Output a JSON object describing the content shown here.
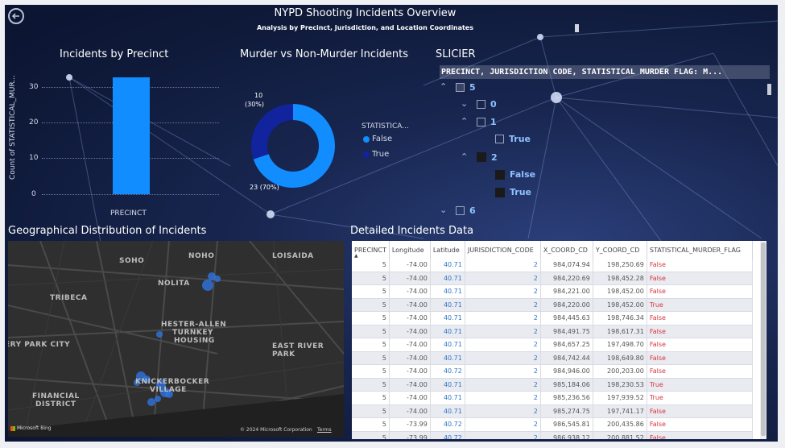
{
  "header": {
    "title": "NYPD Shooting Incidents Overview",
    "subtitle": "Analysis by Precinct, Jurisdiction, and Location Coordinates"
  },
  "bar_panel": {
    "title": "Incidents by Precinct",
    "ylabel": "Count of STATISTICAL_MUR...",
    "xlabel": "PRECINCT",
    "ticks": [
      "0",
      "10",
      "20",
      "30"
    ]
  },
  "donut_panel": {
    "title": "Murder vs Non-Murder Incidents",
    "label_true": "10",
    "label_true_pct": "(30%)",
    "label_false": "23 (70%)",
    "legend_title": "STATISTICA...",
    "legend": [
      {
        "name": "False",
        "color": "#118dff"
      },
      {
        "name": "True",
        "color": "#12239e"
      }
    ]
  },
  "slicer": {
    "title": "SLICIER",
    "header": "PRECINCT, JURISDICTION CODE, STATISTICAL MURDER FLAG: M...",
    "items": [
      "5",
      "0",
      "1",
      "True",
      "2",
      "False",
      "True",
      "6"
    ]
  },
  "map_panel": {
    "title": "Geographical Distribution of Incidents",
    "labels": {
      "soho": "SOHO",
      "noho": "NOHO",
      "loisaida": "LOISAIDA",
      "nolita": "NOLITA",
      "tribeca": "TRIBECA",
      "hester": "HESTER-ALLEN",
      "turnkey": "TURNKEY",
      "housing": "HOUSING",
      "park_city": "ERY PARK CITY",
      "east_river": "EAST RIVER PARK",
      "knickerbocker": "KNICKERBOCKER",
      "village": "VILLAGE",
      "financial": "FINANCIAL",
      "district": "DISTRICT",
      "bing": "Microsoft Bing",
      "copyright": "© 2024 Microsoft Corporation",
      "terms": "Terms"
    }
  },
  "table_panel": {
    "title": "Detailed Incidents Data",
    "columns": [
      "PRECINCT",
      "Longitude",
      "Latitude",
      "JURISDICTION_CODE",
      "X_COORD_CD",
      "Y_COORD_CD",
      "STATISTICAL_MURDER_FLAG"
    ],
    "rows": [
      [
        "5",
        "-74.00",
        "40.71",
        "2",
        "984,074.94",
        "198,250.69",
        "False"
      ],
      [
        "5",
        "-74.00",
        "40.71",
        "2",
        "984,220.69",
        "198,452.28",
        "False"
      ],
      [
        "5",
        "-74.00",
        "40.71",
        "2",
        "984,221.00",
        "198,452.00",
        "False"
      ],
      [
        "5",
        "-74.00",
        "40.71",
        "2",
        "984,220.00",
        "198,452.00",
        "True"
      ],
      [
        "5",
        "-74.00",
        "40.71",
        "2",
        "984,445.63",
        "198,746.34",
        "False"
      ],
      [
        "5",
        "-74.00",
        "40.71",
        "2",
        "984,491.75",
        "198,617.31",
        "False"
      ],
      [
        "5",
        "-74.00",
        "40.71",
        "2",
        "984,657.25",
        "197,498.70",
        "False"
      ],
      [
        "5",
        "-74.00",
        "40.71",
        "2",
        "984,742.44",
        "198,649.80",
        "False"
      ],
      [
        "5",
        "-74.00",
        "40.72",
        "2",
        "984,946.00",
        "200,203.00",
        "False"
      ],
      [
        "5",
        "-74.00",
        "40.71",
        "2",
        "985,184.06",
        "198,230.53",
        "True"
      ],
      [
        "5",
        "-74.00",
        "40.71",
        "2",
        "985,236.56",
        "197,939.52",
        "True"
      ],
      [
        "5",
        "-74.00",
        "40.71",
        "2",
        "985,274.75",
        "197,741.17",
        "False"
      ],
      [
        "5",
        "-73.99",
        "40.72",
        "2",
        "986,545.81",
        "200,435.86",
        "False"
      ],
      [
        "5",
        "-73.99",
        "40.72",
        "2",
        "986,938.12",
        "200,881.52",
        "False"
      ]
    ]
  },
  "chart_data": [
    {
      "type": "bar",
      "title": "Incidents by Precinct",
      "categories": [
        ""
      ],
      "values": [
        33
      ],
      "xlabel": "PRECINCT",
      "ylabel": "Count of STATISTICAL_MUR...",
      "ylim": [
        0,
        35
      ],
      "color": "#118dff"
    },
    {
      "type": "pie",
      "title": "Murder vs Non-Murder Incidents",
      "categories": [
        "False",
        "True"
      ],
      "values": [
        23,
        10
      ],
      "colors": [
        "#118dff",
        "#12239e"
      ]
    }
  ]
}
